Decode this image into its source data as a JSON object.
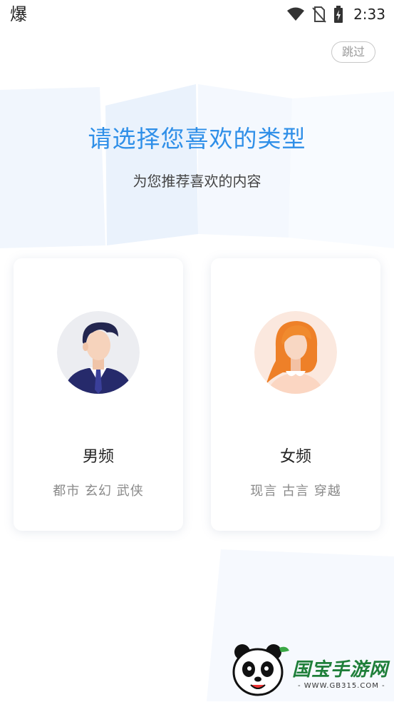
{
  "status_bar": {
    "app_icon_char": "爆",
    "time": "2:33",
    "icons": [
      "wifi-icon",
      "no-sim-icon",
      "battery-charging-icon"
    ]
  },
  "header": {
    "skip_label": "跳过"
  },
  "main": {
    "title": "请选择您喜欢的类型",
    "subtitle": "为您推荐喜欢的内容",
    "options": [
      {
        "label": "男频",
        "tags": "都市 玄幻 武侠",
        "icon": "male-avatar-icon"
      },
      {
        "label": "女频",
        "tags": "现言 古言 穿越",
        "icon": "female-avatar-icon"
      }
    ]
  },
  "watermark": {
    "brand": "国宝手游网",
    "url": "- WWW.GB315.COM -"
  },
  "colors": {
    "accent": "#2f8fe8",
    "tag_gray": "#8a8a8a",
    "male_tie": "#2b2e7a",
    "female_hair": "#f0802a"
  }
}
